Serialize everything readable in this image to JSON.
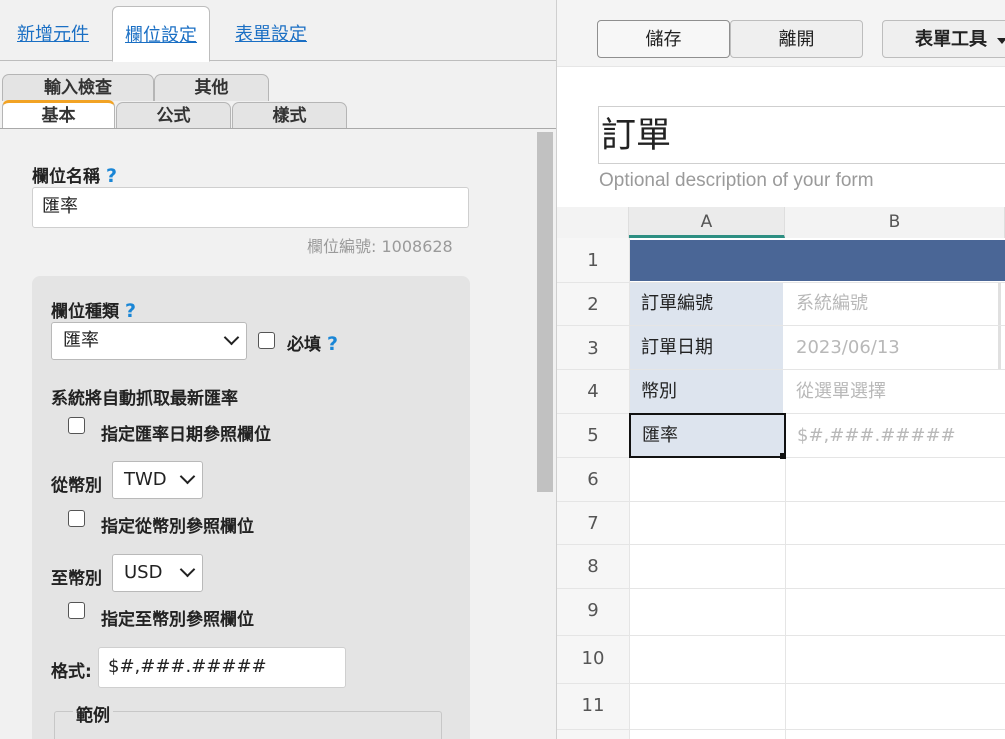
{
  "left_panel": {
    "top_tabs": [
      "新增元件",
      "欄位設定",
      "表單設定"
    ],
    "sub_tabs_row1": [
      "輸入檢查",
      "其他"
    ],
    "sub_tabs_row2": [
      "基本",
      "公式",
      "樣式"
    ],
    "field_name_label": "欄位名稱",
    "help_symbol": "?",
    "field_name_value": "匯率",
    "field_id_text": "欄位編號: 1008628",
    "field_type_label": "欄位種類",
    "field_type_value": "匯率",
    "required_label": "必填",
    "auto_rate_text": "系統將自動抓取最新匯率",
    "rate_date_ref_label": "指定匯率日期參照欄位",
    "from_currency_label": "從幣別",
    "from_currency_value": "TWD",
    "from_currency_ref_label": "指定從幣別參照欄位",
    "to_currency_label": "至幣別",
    "to_currency_value": "USD",
    "to_currency_ref_label": "指定至幣別參照欄位",
    "format_label": "格式:",
    "format_value": "$#,###.#####",
    "example_legend": "範例"
  },
  "right_panel": {
    "toolbar": {
      "save": "儲存",
      "leave": "離開",
      "tools": "表單工具"
    },
    "form_title": "訂單",
    "form_description_placeholder": "Optional description of your form",
    "columns": [
      "A",
      "B"
    ],
    "row_numbers": [
      "1",
      "2",
      "3",
      "4",
      "5",
      "6",
      "7",
      "8",
      "9",
      "10",
      "11"
    ],
    "rows": [
      {
        "label": "訂單編號",
        "value": "系統編號"
      },
      {
        "label": "訂單日期",
        "value": "2023/06/13"
      },
      {
        "label": "幣別",
        "value": "從選單選擇"
      },
      {
        "label": "匯率",
        "value": "$#,###.#####"
      }
    ]
  },
  "colors": {
    "link_blue": "#1a6fc4",
    "help_blue": "#1a86d6",
    "tab_accent": "#f2a324",
    "header_band": "#4a6696",
    "label_cell": "#dde4ee",
    "column_select": "#2d8f82"
  }
}
